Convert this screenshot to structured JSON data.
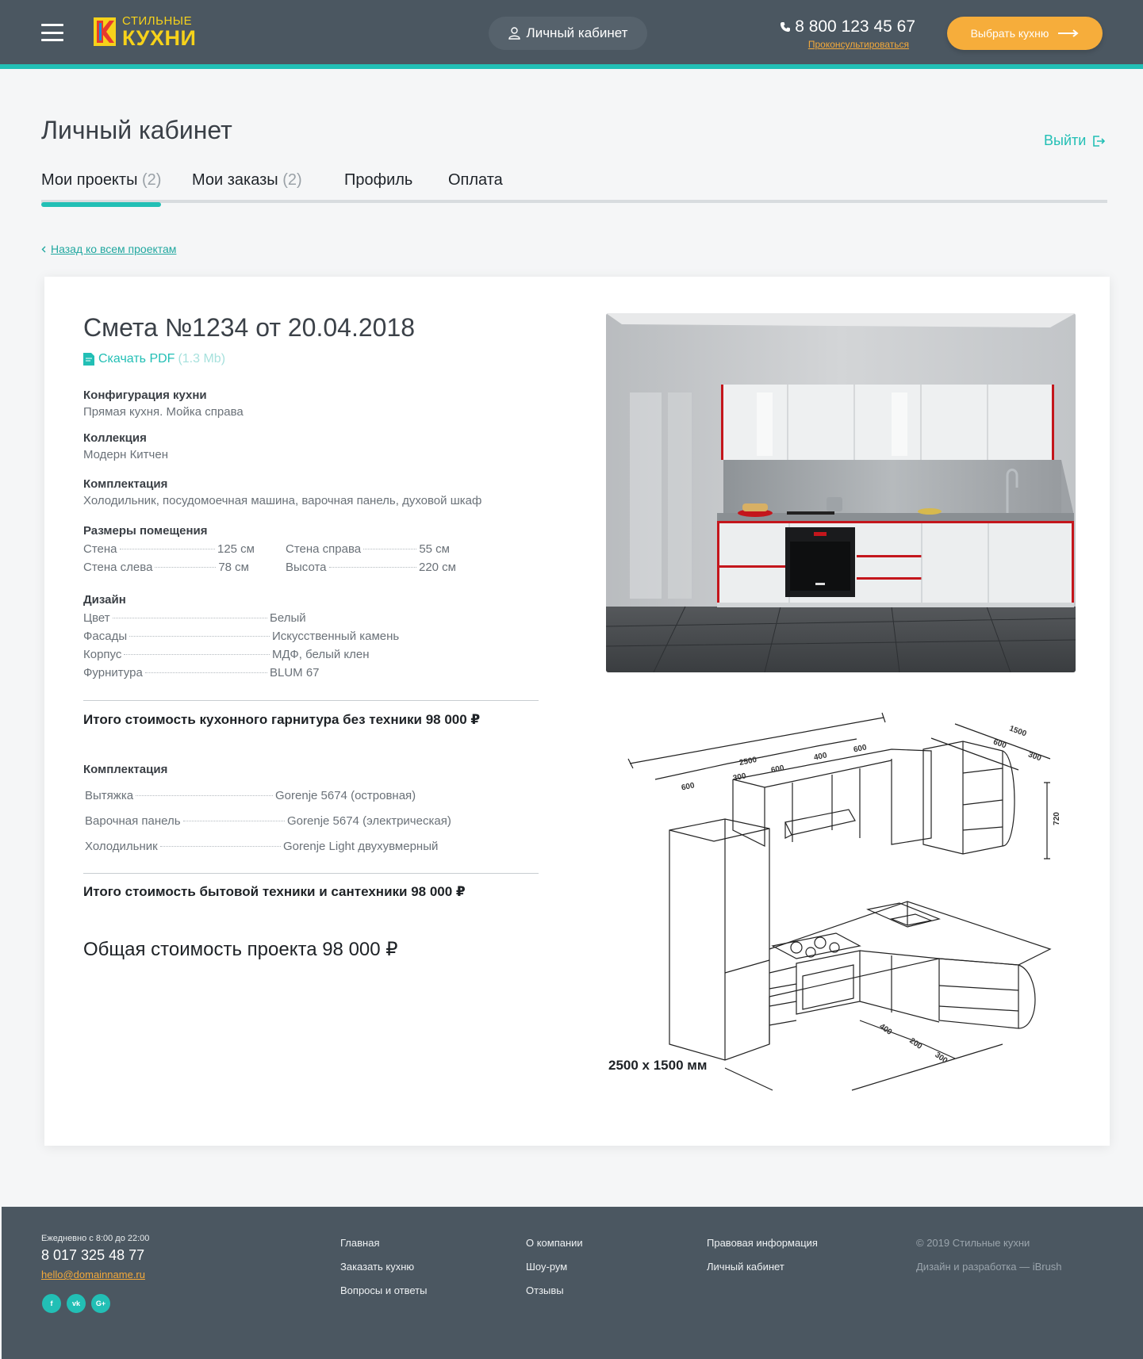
{
  "header": {
    "logo_line1": "СТИЛЬНЫЕ",
    "logo_line2": "КУХНИ",
    "account_label": "Личный кабинет",
    "phone": "8 800 123 45 67",
    "consult_label": "Проконсультироваться",
    "choose_label": "Выбрать кухню",
    "accent_color": "#22bfb5",
    "orange_color": "#f6ad3b"
  },
  "page": {
    "title": "Личный кабинет",
    "logout_label": "Выйти",
    "back_label": "Назад ко всем проектам",
    "tabs": [
      {
        "label": "Мои проекты",
        "count": "(2)"
      },
      {
        "label": "Мои заказы",
        "count": "(2)"
      },
      {
        "label": "Профиль",
        "count": ""
      },
      {
        "label": "Оплата",
        "count": ""
      }
    ]
  },
  "estimate": {
    "title": "Смета №1234 от 20.04.2018",
    "pdf_label": "Скачать PDF",
    "pdf_size": "(1.3 Mb)",
    "config_label": "Конфигурация кухни",
    "config_value": "Прямая кухня. Мойка справа",
    "collection_label": "Коллекция",
    "collection_value": "Модерн Китчен",
    "equipment_label": "Комплектация",
    "equipment_value": "Холодильник, посудомоечная машина, варочная панель, духовой шкаф",
    "room_label": "Размеры помещения",
    "room": [
      {
        "k": "Стена",
        "v": "125 см"
      },
      {
        "k": "Стена справа",
        "v": "55 см"
      },
      {
        "k": "Стена слева",
        "v": "78 см"
      },
      {
        "k": "Высота",
        "v": "220 см"
      }
    ],
    "design_label": "Дизайн",
    "design": [
      {
        "k": "Цвет",
        "v": "Белый"
      },
      {
        "k": "Фасады",
        "v": "Искусственный камень"
      },
      {
        "k": "Корпус",
        "v": "МДФ, белый клен"
      },
      {
        "k": "Фурнитура",
        "v": "BLUM 67"
      }
    ],
    "total_furniture": "Итого стоимость кухонного гарнитура без техники 98 000 ₽",
    "appliances_label": "Комплектация",
    "appliances": [
      {
        "k": "Вытяжка",
        "v": "Gorenje 5674 (островная)"
      },
      {
        "k": "Варочная панель",
        "v": "Gorenje 5674 (электрическая)"
      },
      {
        "k": "Холодильник",
        "v": "Gorenje Light двухувмерный"
      }
    ],
    "total_appliances": "Итого стоимость бытовой техники и сантехники 98 000 ₽",
    "grand_total": "Общая стоимость проекта 98 000 ₽",
    "drawing_caption": "2500 х 1500 мм",
    "drawing_dims": [
      "2500",
      "600",
      "300",
      "600",
      "400",
      "600",
      "1500",
      "600",
      "300",
      "720",
      "400",
      "200",
      "300"
    ]
  },
  "footer": {
    "hours": "Ежедневно с 8:00 до 22:00",
    "phone": "8 017 325 48 77",
    "email": "hello@domainname.ru",
    "socials": [
      "f",
      "vk",
      "G+"
    ],
    "col1": [
      "Главная",
      "Заказать кухню",
      "Вопросы и ответы"
    ],
    "col2": [
      "О компании",
      "Шоу-рум",
      "Отзывы"
    ],
    "col3": [
      "Правовая информация",
      "Личный кабинет"
    ],
    "copyright": "© 2019 Стильные кухни",
    "credits": "Дизайн и разработка — iBrush"
  }
}
